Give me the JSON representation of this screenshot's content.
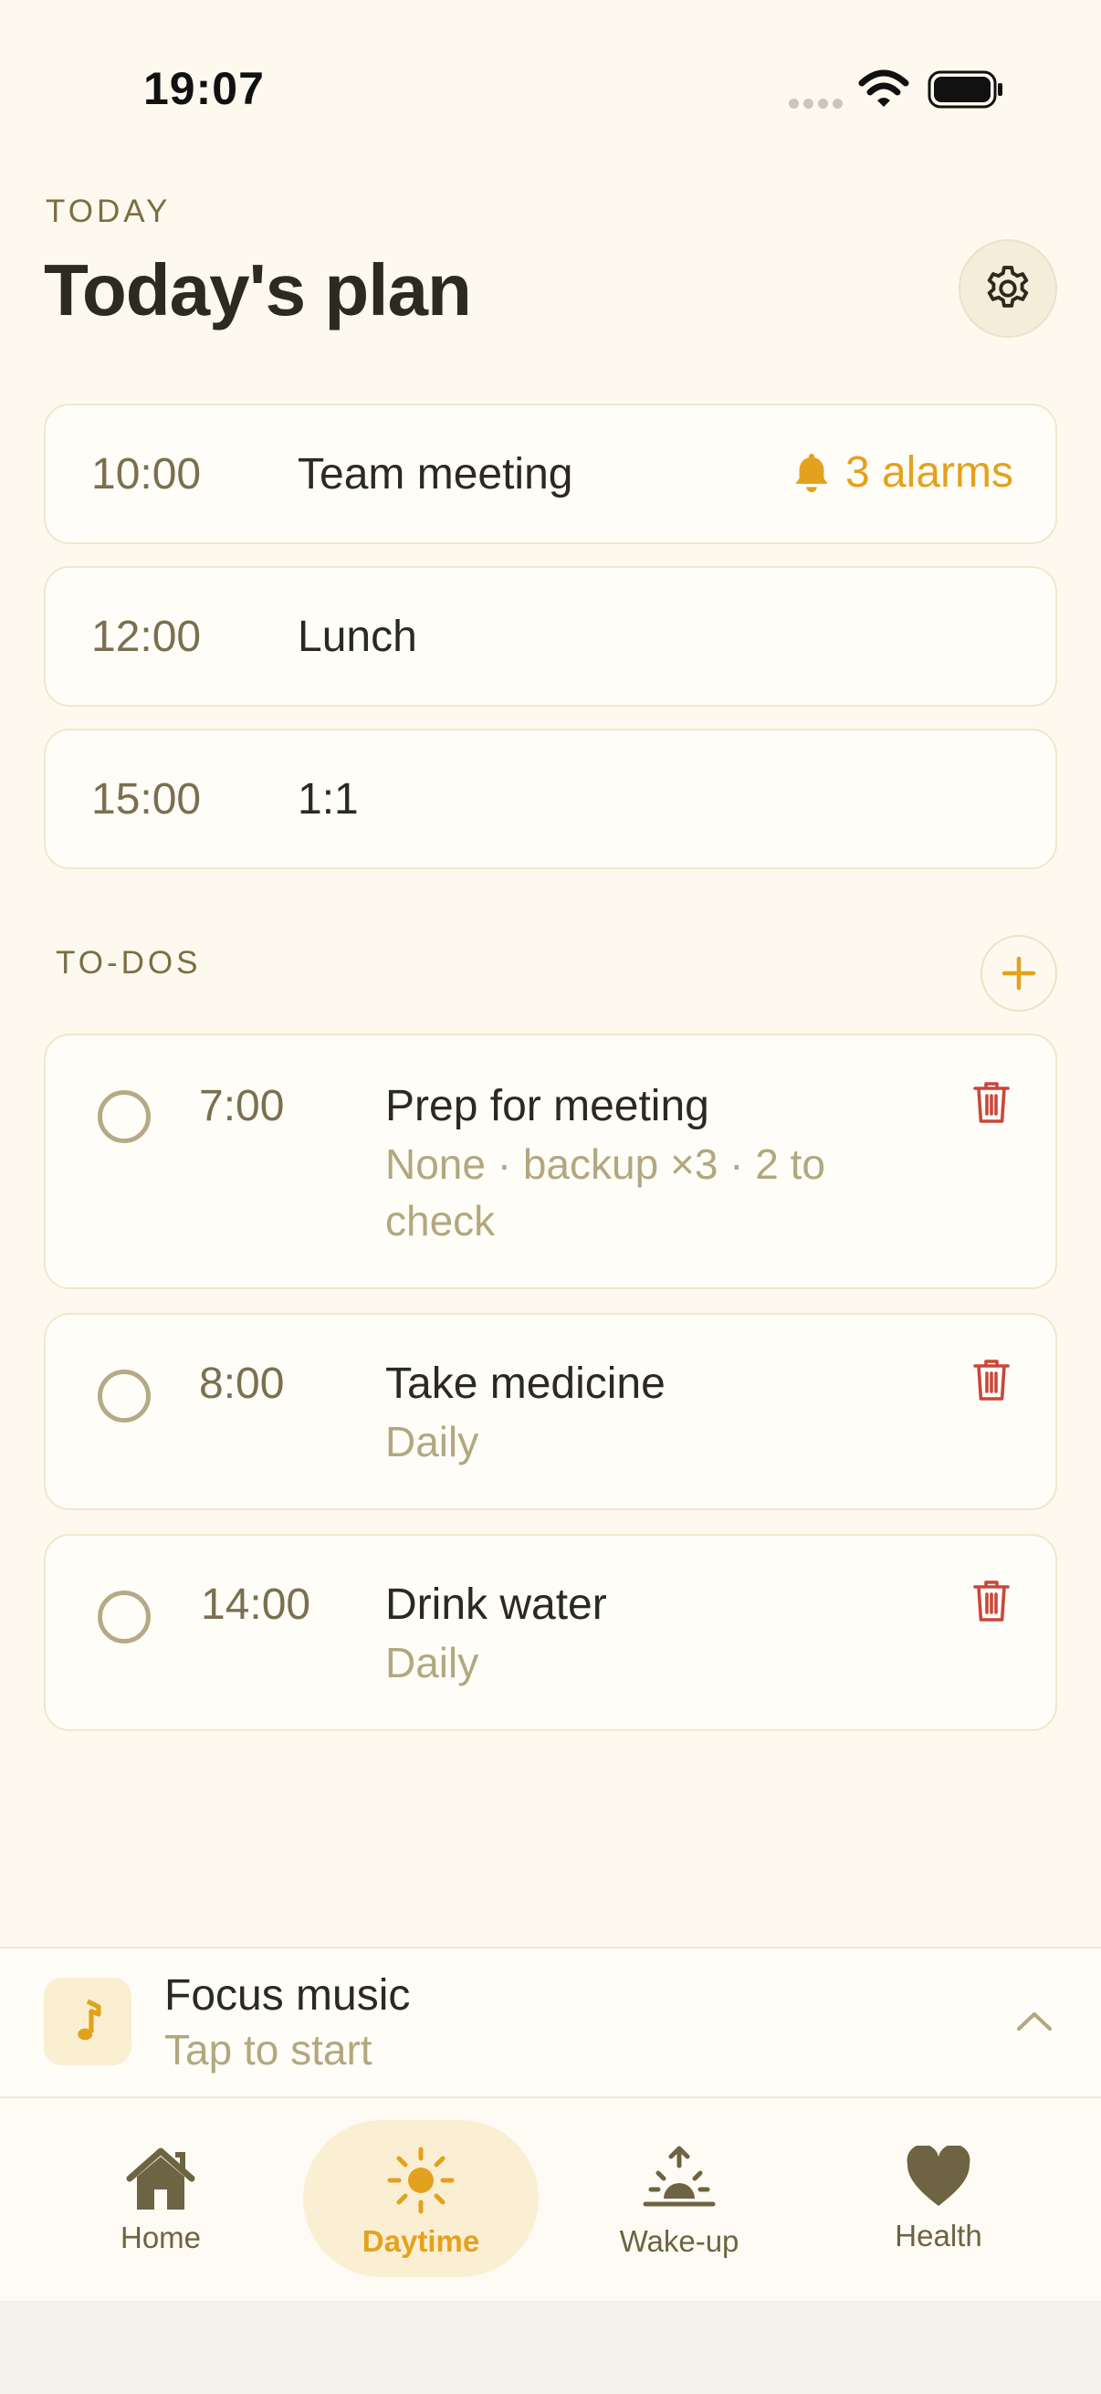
{
  "status_bar": {
    "time": "19:07"
  },
  "header": {
    "kicker": "TODAY",
    "title": "Today's plan"
  },
  "plan": [
    {
      "time": "10:00",
      "title": "Team meeting",
      "alarm": "3 alarms"
    },
    {
      "time": "12:00",
      "title": "Lunch"
    },
    {
      "time": "15:00",
      "title": "1:1"
    }
  ],
  "todos": {
    "label": "TO-DOS",
    "items": [
      {
        "time": "7:00",
        "title": "Prep for meeting",
        "subtitle": "None · backup ×3 · 2 to check",
        "done": false
      },
      {
        "time": "8:00",
        "title": "Take medicine",
        "subtitle": "Daily",
        "done": false
      },
      {
        "time": "14:00",
        "title": "Drink water",
        "subtitle": "Daily",
        "done": false
      }
    ]
  },
  "player": {
    "title": "Focus music",
    "subtitle": "Tap to start",
    "icon": "music-note-icon"
  },
  "tabs": [
    {
      "label": "Home",
      "icon": "home-icon",
      "active": false
    },
    {
      "label": "Daytime",
      "icon": "sun-icon",
      "active": true
    },
    {
      "label": "Wake-up",
      "icon": "sunrise-icon",
      "active": false
    },
    {
      "label": "Health",
      "icon": "heart-icon",
      "active": false
    }
  ],
  "colors": {
    "accent": "#e3a21e",
    "danger": "#c9473b",
    "background": "#fdf9ee",
    "muted": "#b3a77f"
  }
}
